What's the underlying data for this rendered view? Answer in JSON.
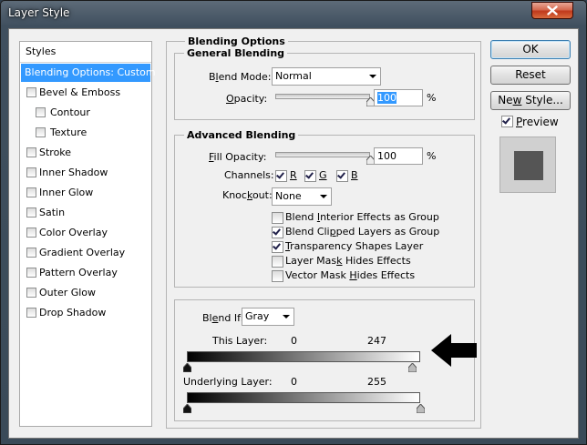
{
  "window": {
    "title": "Layer Style"
  },
  "styles_list": {
    "header": "Styles",
    "items": [
      {
        "label": "Blending Options: Custom",
        "selected": true,
        "has_checkbox": false
      },
      {
        "label": "Bevel & Emboss",
        "checked": false
      },
      {
        "label": "Contour",
        "checked": false,
        "indent": true
      },
      {
        "label": "Texture",
        "checked": false,
        "indent": true
      },
      {
        "label": "Stroke",
        "checked": false
      },
      {
        "label": "Inner Shadow",
        "checked": false
      },
      {
        "label": "Inner Glow",
        "checked": false
      },
      {
        "label": "Satin",
        "checked": false
      },
      {
        "label": "Color Overlay",
        "checked": false
      },
      {
        "label": "Gradient Overlay",
        "checked": false
      },
      {
        "label": "Pattern Overlay",
        "checked": false
      },
      {
        "label": "Outer Glow",
        "checked": false
      },
      {
        "label": "Drop Shadow",
        "checked": false
      }
    ]
  },
  "blending": {
    "header": "Blending Options",
    "general": {
      "header": "General Blending",
      "blend_mode_label_pre": "B",
      "blend_mode_label_ul": "l",
      "blend_mode_label_post": "end Mode:",
      "blend_mode_value": "Normal",
      "opacity_label_ul": "O",
      "opacity_label_post": "pacity:",
      "opacity_value": "100",
      "opacity_fraction": 1.0,
      "percent": "%"
    },
    "advanced": {
      "header": "Advanced Blending",
      "fill_label_ul": "F",
      "fill_label_post": "ill Opacity:",
      "fill_value": "100",
      "fill_fraction": 1.0,
      "percent": "%",
      "channels_label": "Channels:",
      "channels": [
        {
          "label": "R",
          "checked": true
        },
        {
          "label": "G",
          "checked": true
        },
        {
          "label": "B",
          "checked": true
        }
      ],
      "knockout_label_pre": "Knoc",
      "knockout_label_ul": "k",
      "knockout_label_post": "out:",
      "knockout_value": "None",
      "options": [
        {
          "pre": "Blend ",
          "ul": "I",
          "post": "nterior Effects as Group",
          "checked": false
        },
        {
          "pre": "Blend Cli",
          "ul": "p",
          "post": "ped Layers as Group",
          "checked": true
        },
        {
          "pre": "",
          "ul": "T",
          "post": "ransparency Shapes Layer",
          "checked": true
        },
        {
          "pre": "Layer Mas",
          "ul": "k",
          "post": " Hides Effects",
          "checked": false
        },
        {
          "pre": "Vector Mask ",
          "ul": "H",
          "post": "ides Effects",
          "checked": false
        }
      ]
    },
    "blend_if": {
      "label_pre": "Bl",
      "label_ul": "e",
      "label_post": "nd If:",
      "value": "Gray",
      "this_layer": {
        "label": "This Layer:",
        "low": "0",
        "high": "247",
        "low_value": 0,
        "high_value": 247
      },
      "underlying": {
        "label": "Underlying Layer:",
        "low": "0",
        "high": "255",
        "low_value": 0,
        "high_value": 255
      }
    }
  },
  "buttons": {
    "ok": "OK",
    "reset": "Reset",
    "new_style_pre": "Ne",
    "new_style_ul": "w",
    "new_style_post": " Style..."
  },
  "preview": {
    "label_pre": "",
    "label_ul": "P",
    "label_post": "review",
    "checked": true
  },
  "colors": {
    "selection": "#3399ff",
    "dialog_bg": "#f0f0f0",
    "arrow": "#000000"
  }
}
